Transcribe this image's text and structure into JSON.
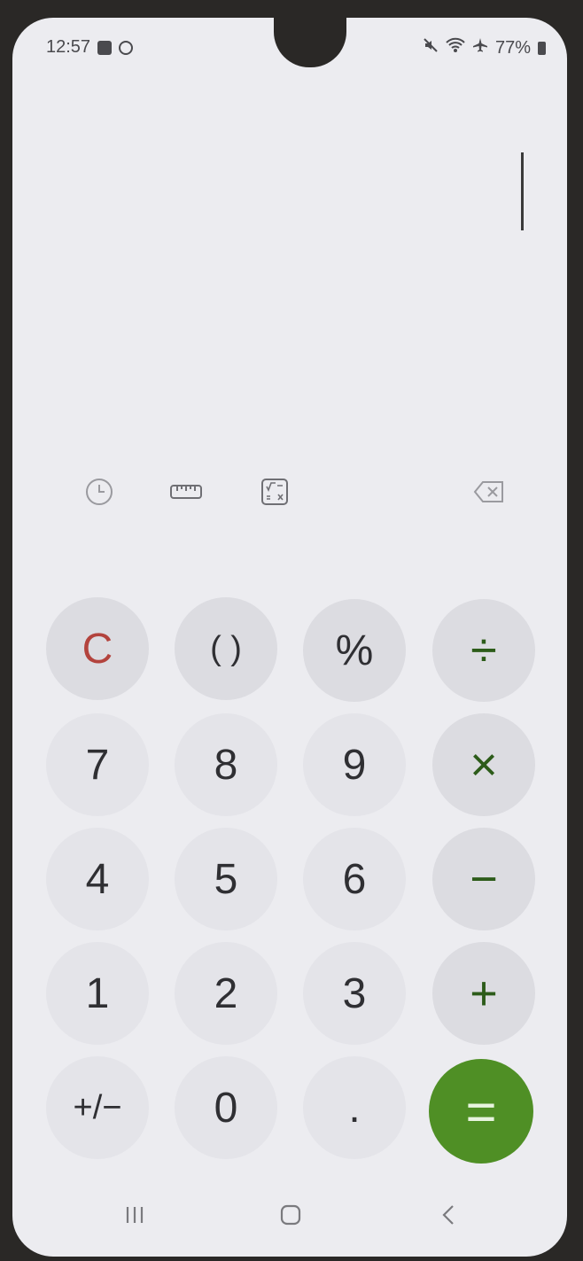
{
  "status_bar": {
    "time": "12:57",
    "battery_text": "77%",
    "icons": [
      "notification-check-icon",
      "notification-app-icon",
      "mute-icon",
      "wifi-icon",
      "airplane-icon",
      "battery-icon"
    ]
  },
  "display": {
    "expression": "",
    "cursor_visible": true
  },
  "tools": {
    "history": "history-clock-icon",
    "unit_converter": "ruler-icon",
    "scientific": "scientific-mode-icon",
    "backspace": "backspace-icon"
  },
  "keys": {
    "clear": "C",
    "parentheses": "( )",
    "percent": "%",
    "divide": "÷",
    "seven": "7",
    "eight": "8",
    "nine": "9",
    "multiply": "×",
    "four": "4",
    "five": "5",
    "six": "6",
    "minus": "−",
    "one": "1",
    "two": "2",
    "three": "3",
    "plus": "+",
    "plus_minus": "+/−",
    "zero": "0",
    "decimal": ".",
    "equals": "="
  },
  "navigation": {
    "recents": "recents-icon",
    "home": "home-icon",
    "back": "back-icon"
  },
  "colors": {
    "background": "#ececf0",
    "key": "#e4e4e9",
    "clear_text": "#b3433d",
    "operator_text": "#2d5c1a",
    "equals_bg": "#4f8f25"
  }
}
